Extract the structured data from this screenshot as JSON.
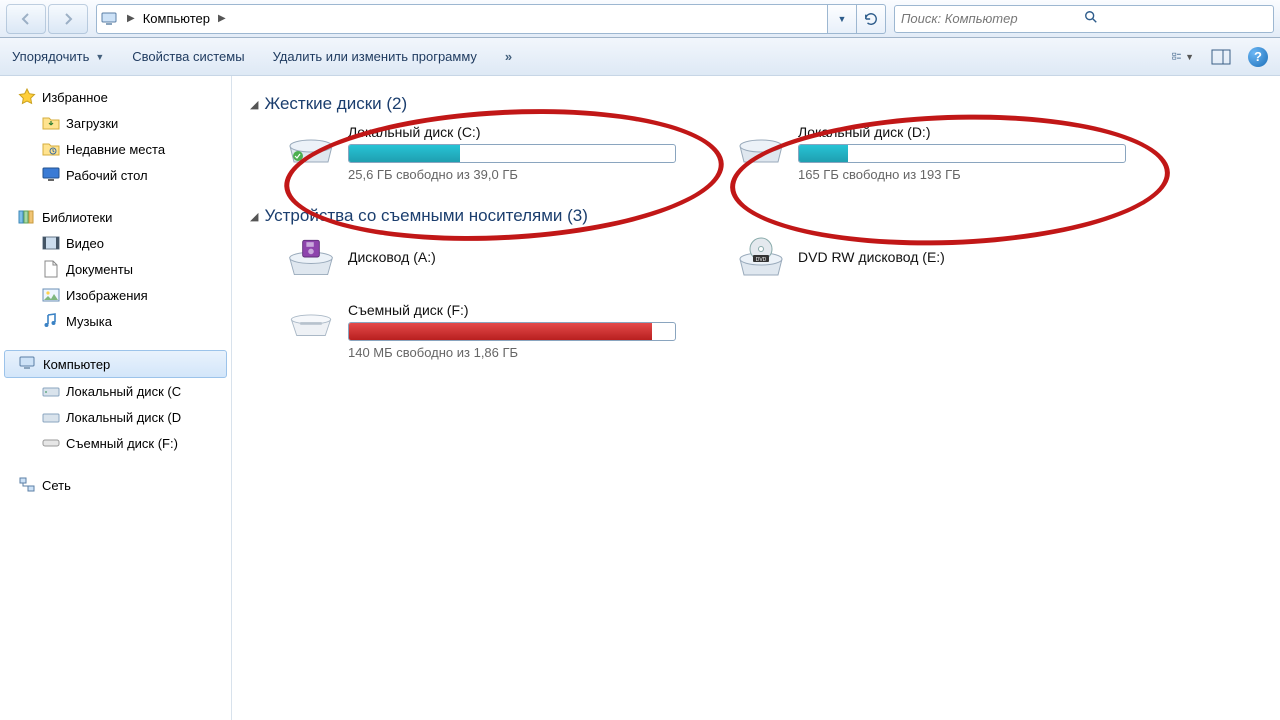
{
  "breadcrumb": {
    "location": "Компьютер",
    "sep": "▶"
  },
  "search": {
    "placeholder": "Поиск: Компьютер"
  },
  "toolbar": {
    "organize": "Упорядочить",
    "sysprops": "Свойства системы",
    "uninstall": "Удалить или изменить программу",
    "overflow": "»"
  },
  "sidebar": {
    "favorites": {
      "header": "Избранное",
      "items": [
        "Загрузки",
        "Недавние места",
        "Рабочий стол"
      ]
    },
    "libraries": {
      "header": "Библиотеки",
      "items": [
        "Видео",
        "Документы",
        "Изображения",
        "Музыка"
      ]
    },
    "computer": {
      "header": "Компьютер",
      "items": [
        "Локальный диск  (C",
        "Локальный диск (D",
        "Съемный диск (F:)"
      ]
    },
    "network": {
      "header": "Сеть"
    }
  },
  "groups": {
    "hdd": "Жесткие диски (2)",
    "removable": "Устройства со съемными носителями (3)"
  },
  "drives": {
    "c": {
      "title": "Локальный диск  (C:)",
      "free": "25,6 ГБ свободно из 39,0 ГБ",
      "fill_pct": 34
    },
    "d": {
      "title": "Локальный диск (D:)",
      "free": "165 ГБ свободно из 193 ГБ",
      "fill_pct": 15
    },
    "a": {
      "title": "Дисковод (A:)"
    },
    "e": {
      "title": "DVD RW дисковод (E:)"
    },
    "f": {
      "title": "Съемный диск (F:)",
      "free": "140 МБ свободно из 1,86 ГБ",
      "fill_pct": 93
    }
  }
}
